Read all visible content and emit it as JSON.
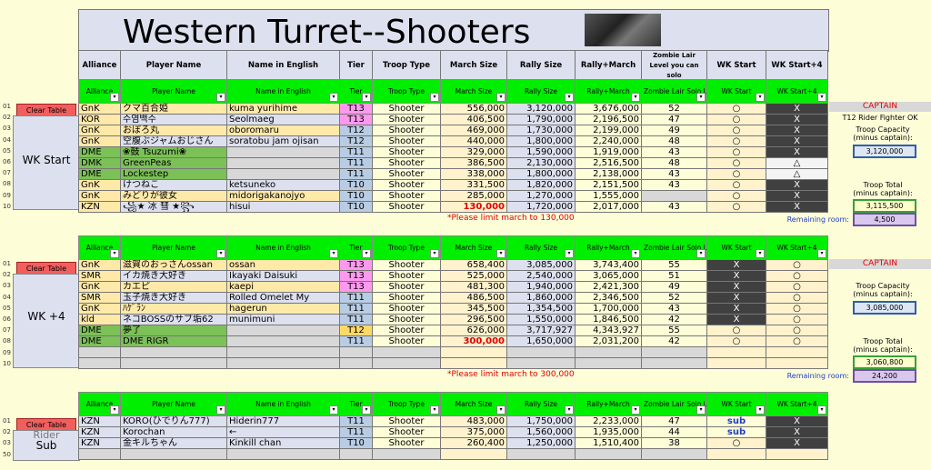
{
  "title": "Western Turret--Shooters",
  "title_headers": [
    "Alliance",
    "Player Name",
    "Name in English",
    "Tier",
    "Troop Type",
    "March Size",
    "Rally Size",
    "Rally+March",
    "Zombie Lair Level you can solo",
    "WK Start",
    "WK Start+4"
  ],
  "filter_headers": [
    "Alliance",
    "Player Name",
    "Name in English",
    "Tier",
    "Troop Type",
    "March Size",
    "Rally Size",
    "Rally+March",
    "Zombie Lair Solo Level",
    "WK Start",
    "WK Start+4"
  ],
  "clear_label": "Clear Table",
  "groups": {
    "wk_start": "WK Start",
    "wk_plus4": "WK +4",
    "sub": "Sub",
    "sub_hidden": "Rider"
  },
  "rownums": {
    "t1": [
      "01",
      "02",
      "03",
      "04",
      "05",
      "06",
      "07",
      "08",
      "09",
      "10"
    ],
    "t2": [
      "01",
      "02",
      "03",
      "04",
      "05",
      "06",
      "07",
      "08",
      "09",
      "10"
    ],
    "t3": [
      "01",
      "02",
      "03",
      "50"
    ]
  },
  "table1": [
    [
      "GnK",
      "クマ百合姫",
      "kuma yurihime",
      "T13",
      "Shooter",
      "556,000",
      "3,120,000",
      "3,676,000",
      "52",
      "○",
      "X"
    ],
    [
      "KOR",
      "수염백수",
      "Seolmaeg",
      "T13",
      "Shooter",
      "406,500",
      "1,790,000",
      "2,196,500",
      "47",
      "○",
      "X"
    ],
    [
      "GnK",
      "おぼろ丸",
      "oboromaru",
      "T12",
      "Shooter",
      "469,000",
      "1,730,000",
      "2,199,000",
      "49",
      "○",
      "X"
    ],
    [
      "GnK",
      "空腹ぶジャムおじさん",
      "soratobu jam ojisan",
      "T12",
      "Shooter",
      "440,000",
      "1,800,000",
      "2,240,000",
      "48",
      "○",
      "X"
    ],
    [
      "DME",
      "❀鼓 Tsuzumi❀",
      "",
      "T11",
      "Shooter",
      "329,000",
      "1,590,000",
      "1,919,000",
      "43",
      "○",
      "X"
    ],
    [
      "DMK",
      "GreenPeas",
      "",
      "T11",
      "Shooter",
      "386,500",
      "2,130,000",
      "2,516,500",
      "48",
      "○",
      "△"
    ],
    [
      "DME",
      "Lockestep",
      "",
      "T11",
      "Shooter",
      "338,000",
      "1,800,000",
      "2,138,000",
      "43",
      "○",
      "△"
    ],
    [
      "GnK",
      "けつねこ",
      "ketsuneko",
      "T10",
      "Shooter",
      "331,500",
      "1,820,000",
      "2,151,500",
      "43",
      "○",
      "X"
    ],
    [
      "GnK",
      "みどりが彼女",
      "midorigakanojyo",
      "T10",
      "Shooter",
      "285,000",
      "1,270,000",
      "1,555,000",
      "",
      "○",
      "X"
    ],
    [
      "KZN",
      "꧁★ 冰 彗 ★꧂",
      "hisui",
      "T10",
      "Shooter",
      "130,000",
      "1,720,000",
      "2,017,000",
      "43",
      "○",
      "X"
    ]
  ],
  "table2": [
    [
      "GnK",
      "滋賀のおっさんossan",
      "ossan",
      "T13",
      "Shooter",
      "658,400",
      "3,085,000",
      "3,743,400",
      "55",
      "X",
      "○"
    ],
    [
      "SMR",
      "イカ焼き大好き",
      "Ikayaki Daisuki",
      "T13",
      "Shooter",
      "525,000",
      "2,540,000",
      "3,065,000",
      "51",
      "X",
      "○"
    ],
    [
      "GnK",
      "カエピ",
      "kaepi",
      "T13",
      "Shooter",
      "481,300",
      "1,940,000",
      "2,421,300",
      "49",
      "X",
      "○"
    ],
    [
      "SMR",
      "玉子焼き大好き",
      "Rolled Omelet My",
      "T11",
      "Shooter",
      "486,500",
      "1,860,000",
      "2,346,500",
      "52",
      "X",
      "○"
    ],
    [
      "GnK",
      "ﾊｹﾞﾗﾝ",
      "hagerun",
      "T11",
      "Shooter",
      "345,500",
      "1,354,500",
      "1,700,000",
      "43",
      "X",
      "○"
    ],
    [
      "kld",
      "ネコBOSSのサブ垢62",
      "munimuni",
      "T11",
      "Shooter",
      "296,500",
      "1,550,000",
      "1,846,500",
      "42",
      "X",
      "○"
    ],
    [
      "DME",
      "夢了",
      "",
      "T12",
      "Shooter",
      "626,000",
      "3,717,927",
      "4,343,927",
      "55",
      "○",
      "○"
    ],
    [
      "DME",
      "DME RIGR",
      "",
      "T11",
      "Shooter",
      "300,000",
      "1,650,000",
      "2,031,200",
      "42",
      "○",
      "○"
    ],
    [
      "",
      "",
      "",
      "",
      "",
      "",
      "",
      "",
      "",
      "",
      ""
    ],
    [
      "",
      "",
      "",
      "",
      "",
      "",
      "",
      "",
      "",
      "",
      ""
    ]
  ],
  "table3": [
    [
      "KZN",
      "KORO(ひでりん777)",
      "Hiderin777",
      "T11",
      "Shooter",
      "483,000",
      "1,750,000",
      "2,233,000",
      "47",
      "sub",
      "X"
    ],
    [
      "KZN",
      "Korochan",
      "←",
      "T11",
      "Shooter",
      "375,000",
      "1,560,000",
      "1,935,000",
      "44",
      "sub",
      "X"
    ],
    [
      "KZN",
      "金キルちゃん",
      "Kinkill chan",
      "T10",
      "Shooter",
      "260,400",
      "1,250,000",
      "1,510,400",
      "38",
      "○",
      "X"
    ],
    [
      "",
      "",
      "",
      "",
      "",
      "",
      "",
      "",
      "",
      "",
      ""
    ]
  ],
  "notes": {
    "limit1": "*Please limit march to 130,000",
    "limit2": "*Please limit march to 300,000"
  },
  "side1": {
    "captain": "CAPTAIN",
    "captain_note": "T12 Rider Fighter OK",
    "capacity_label": "Troop Capacity\n(minus captain):",
    "capacity_value": "3,120,000",
    "total_label": "Troop Total\n(minus captain):",
    "total_value": "3,115,500",
    "remaining_label": "Remaining room:",
    "remaining_value": "4,500"
  },
  "side2": {
    "captain": "CAPTAIN",
    "capacity_label": "Troop Capacity\n(minus captain):",
    "capacity_value": "3,085,000",
    "total_label": "Troop Total\n(minus captain):",
    "total_value": "3,060,800",
    "remaining_label": "Remaining room:",
    "remaining_value": "24,200"
  },
  "colors": {
    "header_green": "#00ee00",
    "captain_red": "#e00000",
    "pink_tier": "#ff99ee",
    "blue_tier": "#b8cce4",
    "alliance_green": "#7cc157"
  }
}
